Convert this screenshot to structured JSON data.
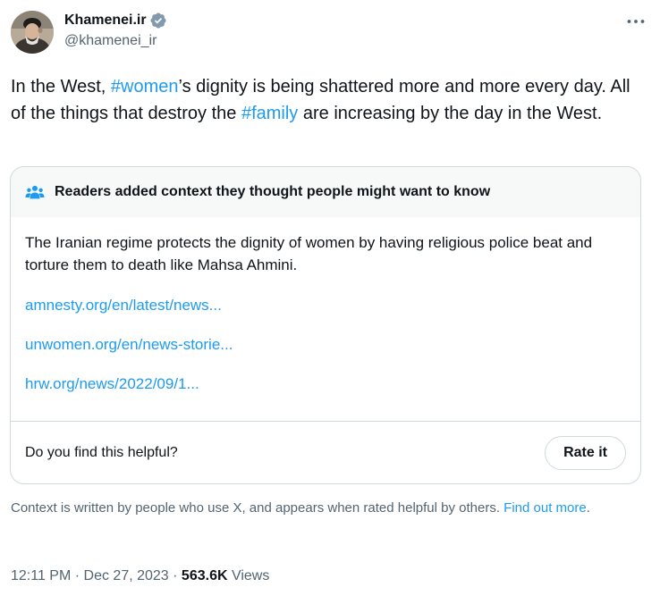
{
  "author": {
    "name": "Khamenei.ir",
    "handle": "@khamenei_ir",
    "verified_color": "#829aab"
  },
  "tweet": {
    "part1": "In the West, ",
    "hashtag1": "#women",
    "part2": "’s dignity is being shattered more and more every day. All of the things that destroy the ",
    "hashtag2": "#family",
    "part3": " are increasing by the day in the West."
  },
  "note": {
    "header": "Readers added context they thought people might want to know",
    "body": "The Iranian regime protects the dignity of women by having religious police beat and torture them to death like Mahsa Ahmini.",
    "links": [
      "amnesty.org/en/latest/news...",
      "unwomen.org/en/news-storie...",
      "hrw.org/news/2022/09/1..."
    ],
    "helpful_prompt": "Do you find this helpful?",
    "rate_button": "Rate it"
  },
  "context": {
    "text": "Context is written by people who use X, and appears when rated helpful by others. ",
    "find_out": "Find out more",
    "period": "."
  },
  "meta": {
    "time": "12:11 PM",
    "separator1": " · ",
    "date": "Dec 27, 2023",
    "separator2": " · ",
    "views": "563.6K",
    "views_label": " Views"
  },
  "icons": {
    "more": "more-horizontal-icon",
    "note_header": "people-icon",
    "verified": "verified-badge-icon"
  },
  "colors": {
    "link": "#1d9bf0",
    "note_header_bg": "#f7f9f9",
    "secondary_text": "#536471"
  }
}
